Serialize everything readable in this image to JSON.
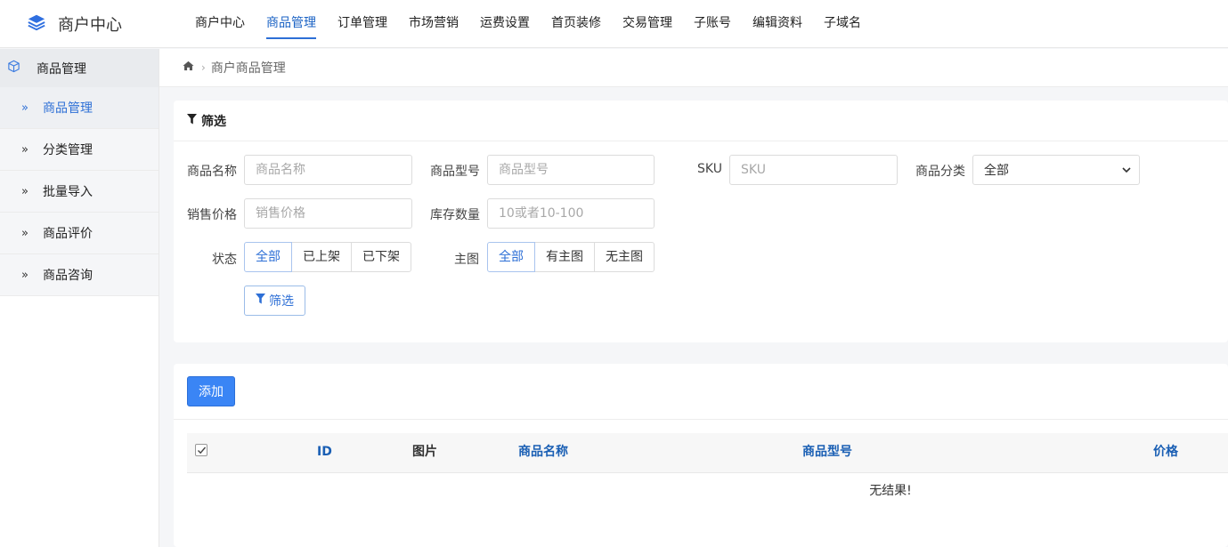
{
  "header": {
    "app_title": "商户中心",
    "nav": [
      {
        "label": "商户中心",
        "active": false
      },
      {
        "label": "商品管理",
        "active": true
      },
      {
        "label": "订单管理",
        "active": false
      },
      {
        "label": "市场营销",
        "active": false
      },
      {
        "label": "运费设置",
        "active": false
      },
      {
        "label": "首页装修",
        "active": false
      },
      {
        "label": "交易管理",
        "active": false
      },
      {
        "label": "子账号",
        "active": false
      },
      {
        "label": "编辑资料",
        "active": false
      },
      {
        "label": "子域名",
        "active": false
      }
    ]
  },
  "sidebar": {
    "section_title": "商品管理",
    "items": [
      {
        "label": "商品管理",
        "active": true
      },
      {
        "label": "分类管理",
        "active": false
      },
      {
        "label": "批量导入",
        "active": false
      },
      {
        "label": "商品评价",
        "active": false
      },
      {
        "label": "商品咨询",
        "active": false
      }
    ]
  },
  "breadcrumb": {
    "current": "商户商品管理"
  },
  "filter": {
    "title": "筛选",
    "name_label": "商品名称",
    "name_placeholder": "商品名称",
    "model_label": "商品型号",
    "model_placeholder": "商品型号",
    "sku_label": "SKU",
    "sku_placeholder": "SKU",
    "category_label": "商品分类",
    "category_value": "全部",
    "price_label": "销售价格",
    "price_placeholder": "销售价格",
    "stock_label": "库存数量",
    "stock_placeholder": "10或者10-100",
    "status_label": "状态",
    "status_options": [
      "全部",
      "已上架",
      "已下架"
    ],
    "image_label": "主图",
    "image_options": [
      "全部",
      "有主图",
      "无主图"
    ],
    "submit_label": "筛选"
  },
  "list": {
    "add_label": "添加",
    "columns": [
      "ID",
      "图片",
      "商品名称",
      "商品型号",
      "价格"
    ],
    "empty_text": "无结果!"
  },
  "colors": {
    "accent": "#2d6fd6",
    "primary_button": "#3a85f5",
    "sortable_header": "#1a5fb4"
  }
}
